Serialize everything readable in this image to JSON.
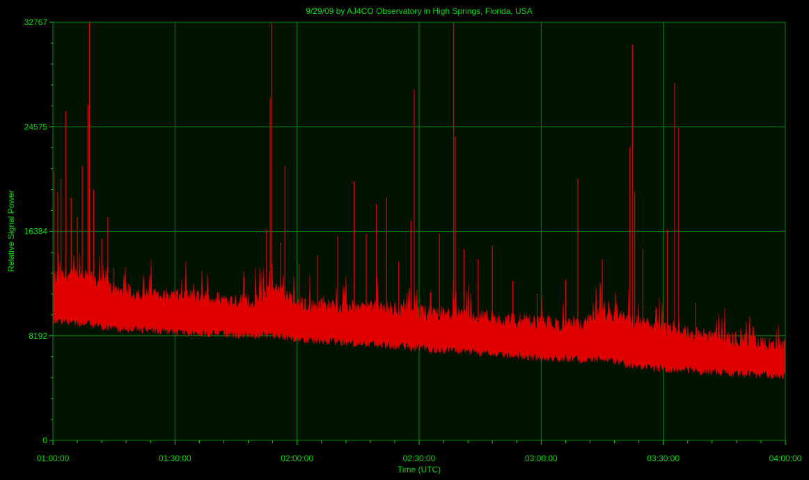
{
  "chart_data": {
    "type": "area",
    "title": "9/29/09  by  AJ4CO Observatory  in  High Springs, Florida, USA",
    "xlabel": "Time (UTC)",
    "ylabel": "Relative Signal Power",
    "x_ticks": [
      "01:00:00",
      "01:30:00",
      "02:00:00",
      "02:30:00",
      "03:00:00",
      "03:30:00",
      "04:00:00"
    ],
    "y_ticks": [
      "0",
      "8192",
      "16384",
      "24575",
      "32767"
    ],
    "xlim": [
      0,
      180
    ],
    "ylim": [
      0,
      32767
    ],
    "grid": true,
    "colors": {
      "background": "#000000",
      "plot_background": "#001300",
      "grid": "#008a00",
      "text": "#00dd00",
      "series": "#e00000"
    },
    "series": [
      {
        "envelope_x_minutes": [
          0,
          5,
          10,
          15,
          20,
          30,
          40,
          50,
          53,
          56,
          60,
          70,
          80,
          90,
          100,
          110,
          120,
          130,
          135,
          140,
          150,
          160,
          170,
          175,
          180
        ],
        "baseline": [
          9800,
          9600,
          9400,
          9200,
          9100,
          8900,
          8700,
          8600,
          8650,
          8500,
          8350,
          8100,
          7900,
          7600,
          7400,
          7100,
          6900,
          6700,
          6900,
          6400,
          6000,
          5800,
          5600,
          5500,
          5400
        ],
        "top": [
          12500,
          12700,
          12400,
          11500,
          11200,
          11000,
          10800,
          10600,
          11600,
          11400,
          10400,
          10200,
          10100,
          9800,
          9600,
          9200,
          8900,
          8600,
          9800,
          9200,
          8400,
          7900,
          7600,
          7200,
          7000
        ],
        "peaks": [
          {
            "x": 0.3,
            "y": 21000
          },
          {
            "x": 1.2,
            "y": 19500
          },
          {
            "x": 2.0,
            "y": 20500
          },
          {
            "x": 3.2,
            "y": 25800
          },
          {
            "x": 4.5,
            "y": 19000
          },
          {
            "x": 6.0,
            "y": 17500
          },
          {
            "x": 7.2,
            "y": 21500
          },
          {
            "x": 8.6,
            "y": 26300
          },
          {
            "x": 9.0,
            "y": 32767
          },
          {
            "x": 10.0,
            "y": 19600
          },
          {
            "x": 12.0,
            "y": 15800
          },
          {
            "x": 13.5,
            "y": 17500
          },
          {
            "x": 15.0,
            "y": 13500
          },
          {
            "x": 18.5,
            "y": 12300
          },
          {
            "x": 47.0,
            "y": 12800
          },
          {
            "x": 52.5,
            "y": 16500
          },
          {
            "x": 53.4,
            "y": 26800
          },
          {
            "x": 53.7,
            "y": 32767
          },
          {
            "x": 56.0,
            "y": 15500
          },
          {
            "x": 57.0,
            "y": 21500
          },
          {
            "x": 60.5,
            "y": 13800
          },
          {
            "x": 65.0,
            "y": 14500
          },
          {
            "x": 70.0,
            "y": 16000
          },
          {
            "x": 74.0,
            "y": 20300
          },
          {
            "x": 77.0,
            "y": 16200
          },
          {
            "x": 79.5,
            "y": 18500
          },
          {
            "x": 82.0,
            "y": 19000
          },
          {
            "x": 85.0,
            "y": 14000
          },
          {
            "x": 88.0,
            "y": 17200
          },
          {
            "x": 88.8,
            "y": 27500
          },
          {
            "x": 95.0,
            "y": 16200
          },
          {
            "x": 98.5,
            "y": 32767
          },
          {
            "x": 98.9,
            "y": 23800
          },
          {
            "x": 101.0,
            "y": 15000
          },
          {
            "x": 104.5,
            "y": 14200
          },
          {
            "x": 108.0,
            "y": 15200
          },
          {
            "x": 113.0,
            "y": 12500
          },
          {
            "x": 119.0,
            "y": 11500
          },
          {
            "x": 126.0,
            "y": 12600
          },
          {
            "x": 129.0,
            "y": 20500
          },
          {
            "x": 135.0,
            "y": 14200
          },
          {
            "x": 141.8,
            "y": 23000
          },
          {
            "x": 142.4,
            "y": 31000
          },
          {
            "x": 143.0,
            "y": 19500
          },
          {
            "x": 145.0,
            "y": 15000
          },
          {
            "x": 151.0,
            "y": 16500
          },
          {
            "x": 152.8,
            "y": 28000
          },
          {
            "x": 153.8,
            "y": 24500
          },
          {
            "x": 158.0,
            "y": 10800
          },
          {
            "x": 165.0,
            "y": 9200
          },
          {
            "x": 172.0,
            "y": 8900
          }
        ]
      }
    ]
  }
}
